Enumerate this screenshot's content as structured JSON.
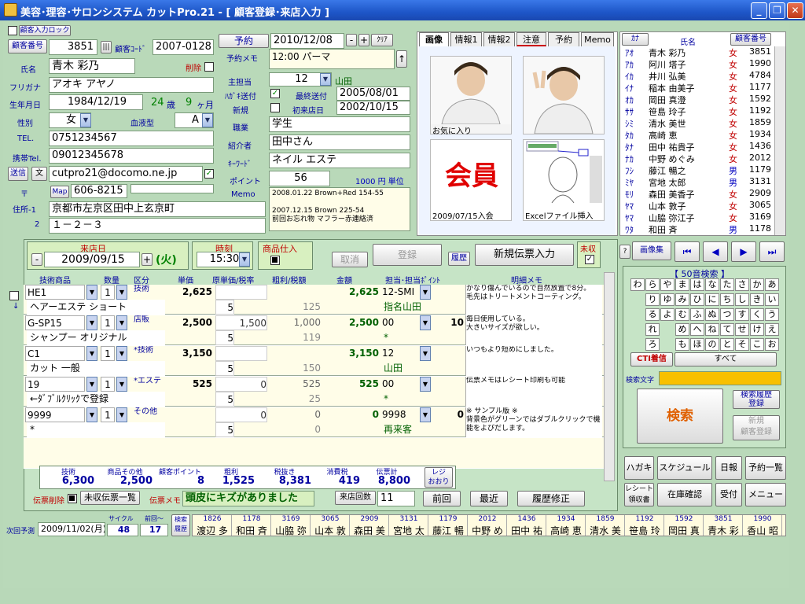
{
  "window": {
    "title": "美容･理容･サロンシステム カットPro.21 - [ 顧客登録･来店入力 ]",
    "min": "_",
    "restore": "❐",
    "close": "✕"
  },
  "customer": {
    "entry_lock": "顧客入力ロック",
    "no_label": "顧客番号",
    "no": "3851",
    "code_label": "顧客ｺｰﾄﾞ",
    "code": "2007-0128",
    "name_label": "氏名",
    "name": "青木 彩乃",
    "delete_label": "削除",
    "furigana_label": "フリガナ",
    "furigana": "アオキ アヤノ",
    "birth_label": "生年月日",
    "birth": "1984/12/19",
    "age": "24",
    "age_unit": "歳",
    "month": "9",
    "month_unit": "ヶ月",
    "sex_label": "性別",
    "sex": "女",
    "blood_label": "血液型",
    "blood": "A",
    "tel_label": "TEL.",
    "tel": "0751234567",
    "mobile_label": "携帯Tel.",
    "mobile": "09012345678",
    "send_btn": "送信",
    "text_btn": "文",
    "email": "cutpro21@docomo.ne.jp",
    "zip_label": "〒",
    "map_btn": "Map",
    "zip": "606-8215",
    "addr1_label": "住所-1",
    "addr1": "京都市左京区田中上玄京町",
    "addr2_label": "2",
    "addr2": "１－２－３"
  },
  "mid": {
    "reserve_btn": "予約",
    "reserve_date": "2010/12/08",
    "minus": "-",
    "plus": "+",
    "clear": "ｸﾘｱ",
    "memo_label": "予約メモ",
    "memo": "12:00 パーマ",
    "up": "↑",
    "staff_label": "主担当",
    "staff": "12",
    "staff_name": "山田",
    "postcard_label": "ﾊｶﾞｷ送付",
    "last_send_label": "最終送付",
    "last_send": "2005/08/01",
    "new_label": "新規",
    "first_visit_label": "初来店日",
    "first_visit": "2002/10/15",
    "job_label": "職業",
    "job": "学生",
    "intro_label": "紹介者",
    "intro": "田中さん",
    "keyword_label": "ｷｰﾜｰﾄﾞ",
    "keyword": "ネイル エステ",
    "point_label": "ポイント",
    "point": "56",
    "unit": "1000 円 単位",
    "memo2_label": "Memo",
    "memo2": [
      "2008.01.22 Brown+Red 154-55",
      "",
      "2007.12.15 Brown 225-54",
      "前回お忘れ物 マフラー赤連絡済"
    ]
  },
  "tabs": [
    "画像",
    "情報1",
    "情報2",
    "注意",
    "予約",
    "Memo"
  ],
  "images": {
    "cap1": "お気に入り",
    "member": "会員",
    "cap3": "2009/07/15入会",
    "cap4": "Excelファイル挿入"
  },
  "list": {
    "headers": [
      "ｶﾅ",
      "氏名",
      "顧客番号"
    ],
    "rows": [
      [
        "ｱｵ",
        "青木 彩乃",
        "女",
        "3851"
      ],
      [
        "ｱｶ",
        "阿川 塔子",
        "女",
        "1990"
      ],
      [
        "ｲｶ",
        "井川 弘美",
        "女",
        "4784"
      ],
      [
        "ｲﾅ",
        "稲本 由美子",
        "女",
        "1177"
      ],
      [
        "ｵｶ",
        "岡田 真澄",
        "女",
        "1592"
      ],
      [
        "ｻｻ",
        "笹島 玲子",
        "女",
        "1192"
      ],
      [
        "ｼﾐ",
        "清水 美世",
        "女",
        "1859"
      ],
      [
        "ﾀｶ",
        "高崎 恵",
        "女",
        "1934"
      ],
      [
        "ﾀﾅ",
        "田中 祐貴子",
        "女",
        "1436"
      ],
      [
        "ﾅｶ",
        "中野 めぐみ",
        "女",
        "2012"
      ],
      [
        "ﾌｼ",
        "藤江 暢之",
        "男",
        "1179"
      ],
      [
        "ﾐﾔ",
        "宮地 太郎",
        "男",
        "3131"
      ],
      [
        "ﾓﾘ",
        "森田 美香子",
        "女",
        "2909"
      ],
      [
        "ﾔﾏ",
        "山本 敦子",
        "女",
        "3065"
      ],
      [
        "ﾔﾏ",
        "山脇 弥江子",
        "女",
        "3169"
      ],
      [
        "ﾜﾀ",
        "和田 斉",
        "男",
        "1178"
      ]
    ]
  },
  "visit": {
    "date_label": "来店日",
    "date": "2009/09/15",
    "dow": "(火)",
    "time_label": "時刻",
    "time": "15:30",
    "stock_label": "商品仕入",
    "cancel": "取消",
    "register": "登録",
    "history": "履歴",
    "new_slip": "新規伝票入力",
    "unpaid_label": "未収"
  },
  "grid": {
    "headers": [
      "技術商品",
      "数量",
      "区分",
      "単価",
      "原単価/税率",
      "粗利/税額",
      "金額",
      "担当･担当ﾎﾟｲﾝﾄ",
      "明細メモ"
    ],
    "rows": [
      {
        "item": "HE1",
        "qty": "1",
        "cat": "技術",
        "price": "2,625",
        "cost": "",
        "profit": "",
        "amt": "2,625",
        "staff": "12-SMI",
        "sp": "",
        "sub": "ヘアーエステ ショート",
        "tax": "5",
        "taxamt": "125",
        "staff2": "指名山田",
        "memo": "かなり傷んでいるので自然放置で8分。\n毛先はトリートメントコーティング。"
      },
      {
        "item": "G-SP15",
        "qty": "1",
        "cat": "店販",
        "price": "2,500",
        "cost": "1,500",
        "profit": "1,000",
        "amt": "2,500",
        "staff": "00",
        "sp": "10",
        "sub": "シャンプー オリジナル",
        "tax": "5",
        "taxamt": "119",
        "staff2": "*",
        "memo": "毎日使用している。\n大きいサイズが欲しい。"
      },
      {
        "item": "C1",
        "qty": "1",
        "cat": "*技術",
        "price": "3,150",
        "cost": "",
        "profit": "",
        "amt": "3,150",
        "staff": "12",
        "sp": "",
        "sub": "カット 一般",
        "tax": "5",
        "taxamt": "150",
        "staff2": "山田",
        "memo": "いつもより短めにしました。"
      },
      {
        "item": "19",
        "qty": "1",
        "cat": "*エステ",
        "price": "525",
        "cost": "0",
        "profit": "525",
        "amt": "525",
        "staff": "00",
        "sp": "",
        "sub": "←ﾀﾞﾌﾞﾙｸﾘｯｸで登録",
        "tax": "5",
        "taxamt": "25",
        "staff2": "*",
        "memo": "伝票メモはレシート印刷も可能"
      },
      {
        "item": "9999",
        "qty": "1",
        "cat": "その他",
        "price": "",
        "cost": "0",
        "profit": "0",
        "amt": "0",
        "staff": "9998",
        "sp": "0",
        "sub": "*",
        "tax": "5",
        "taxamt": "0",
        "staff2": "再来客",
        "memo": "※ サンプル版 ※\n背景色がグリーンではダブルクリックで機能をよびだします。"
      }
    ]
  },
  "totals": {
    "labels": [
      "技術",
      "商品その他",
      "顧客ポイント",
      "粗利",
      "税抜き",
      "消費税",
      "伝票計"
    ],
    "values": [
      "6,300",
      "2,500",
      "8",
      "1,525",
      "8,381",
      "419",
      "8,800"
    ],
    "receipt": "レジ\nおおり"
  },
  "bottom": {
    "slip_delete": "伝票削除",
    "unpaid_list": "未収伝票一覧",
    "memo_label": "伝票メモ",
    "memo": "頭皮にキズがありました",
    "count_btn": "来店回数",
    "count": "11",
    "prev": "前回",
    "recent": "最近",
    "fix": "履歴修正",
    "next_label": "次回予測",
    "next_date": "2009/11/02(月)",
    "cycle_label": "サイクル",
    "last_label": "前回～",
    "cycle": "48",
    "last": "17",
    "search_hist": "検索\n履歴"
  },
  "history": [
    [
      "1826",
      "渡辺 多"
    ],
    [
      "1178",
      "和田 斉"
    ],
    [
      "3169",
      "山脇 弥"
    ],
    [
      "3065",
      "山本 敦"
    ],
    [
      "2909",
      "森田 美"
    ],
    [
      "3131",
      "宮地 太"
    ],
    [
      "1179",
      "藤江 暢"
    ],
    [
      "2012",
      "中野 め"
    ],
    [
      "1436",
      "田中 祐"
    ],
    [
      "1934",
      "高崎 恵"
    ],
    [
      "1859",
      "清水 美"
    ],
    [
      "1192",
      "笹島 玲"
    ],
    [
      "1592",
      "岡田 真"
    ],
    [
      "3851",
      "青木 彩"
    ],
    [
      "1990",
      "香山 昭"
    ]
  ],
  "right": {
    "image_collection": "画像集",
    "help": "?",
    "nav": [
      "⏮",
      "◀",
      "▶",
      "⏭"
    ],
    "kana_title": "【 50音検索 】",
    "kana_rows": [
      [
        "わ",
        "ら",
        "や",
        "ま",
        "は",
        "な",
        "た",
        "さ",
        "か",
        "あ"
      ],
      [
        "",
        "り",
        "ゆ",
        "み",
        "ひ",
        "に",
        "ち",
        "し",
        "き",
        "い"
      ],
      [
        "",
        "る",
        "よ",
        "む",
        "ふ",
        "ぬ",
        "つ",
        "す",
        "く",
        "う"
      ],
      [
        "",
        "れ",
        "",
        "め",
        "へ",
        "ね",
        "て",
        "せ",
        "け",
        "え"
      ],
      [
        "",
        "ろ",
        "",
        "も",
        "ほ",
        "の",
        "と",
        "そ",
        "こ",
        "お"
      ]
    ],
    "cti": "CTI着信",
    "all": "すべて",
    "search_text_label": "検索文字",
    "search": "検索",
    "search_hist_reg": "検索履歴\n登録",
    "new_reg": "新規\n顧客登録",
    "btns": [
      "ハガキ",
      "スケジュール",
      "日報",
      "予約一覧",
      "レシート\n領収書",
      "在庫確認",
      "受付",
      "メニュー"
    ]
  },
  "colors": {
    "title": "#1e56c8",
    "label": "#0000a0",
    "green_field": "#d8f0c0",
    "member_red": "#e00000"
  }
}
